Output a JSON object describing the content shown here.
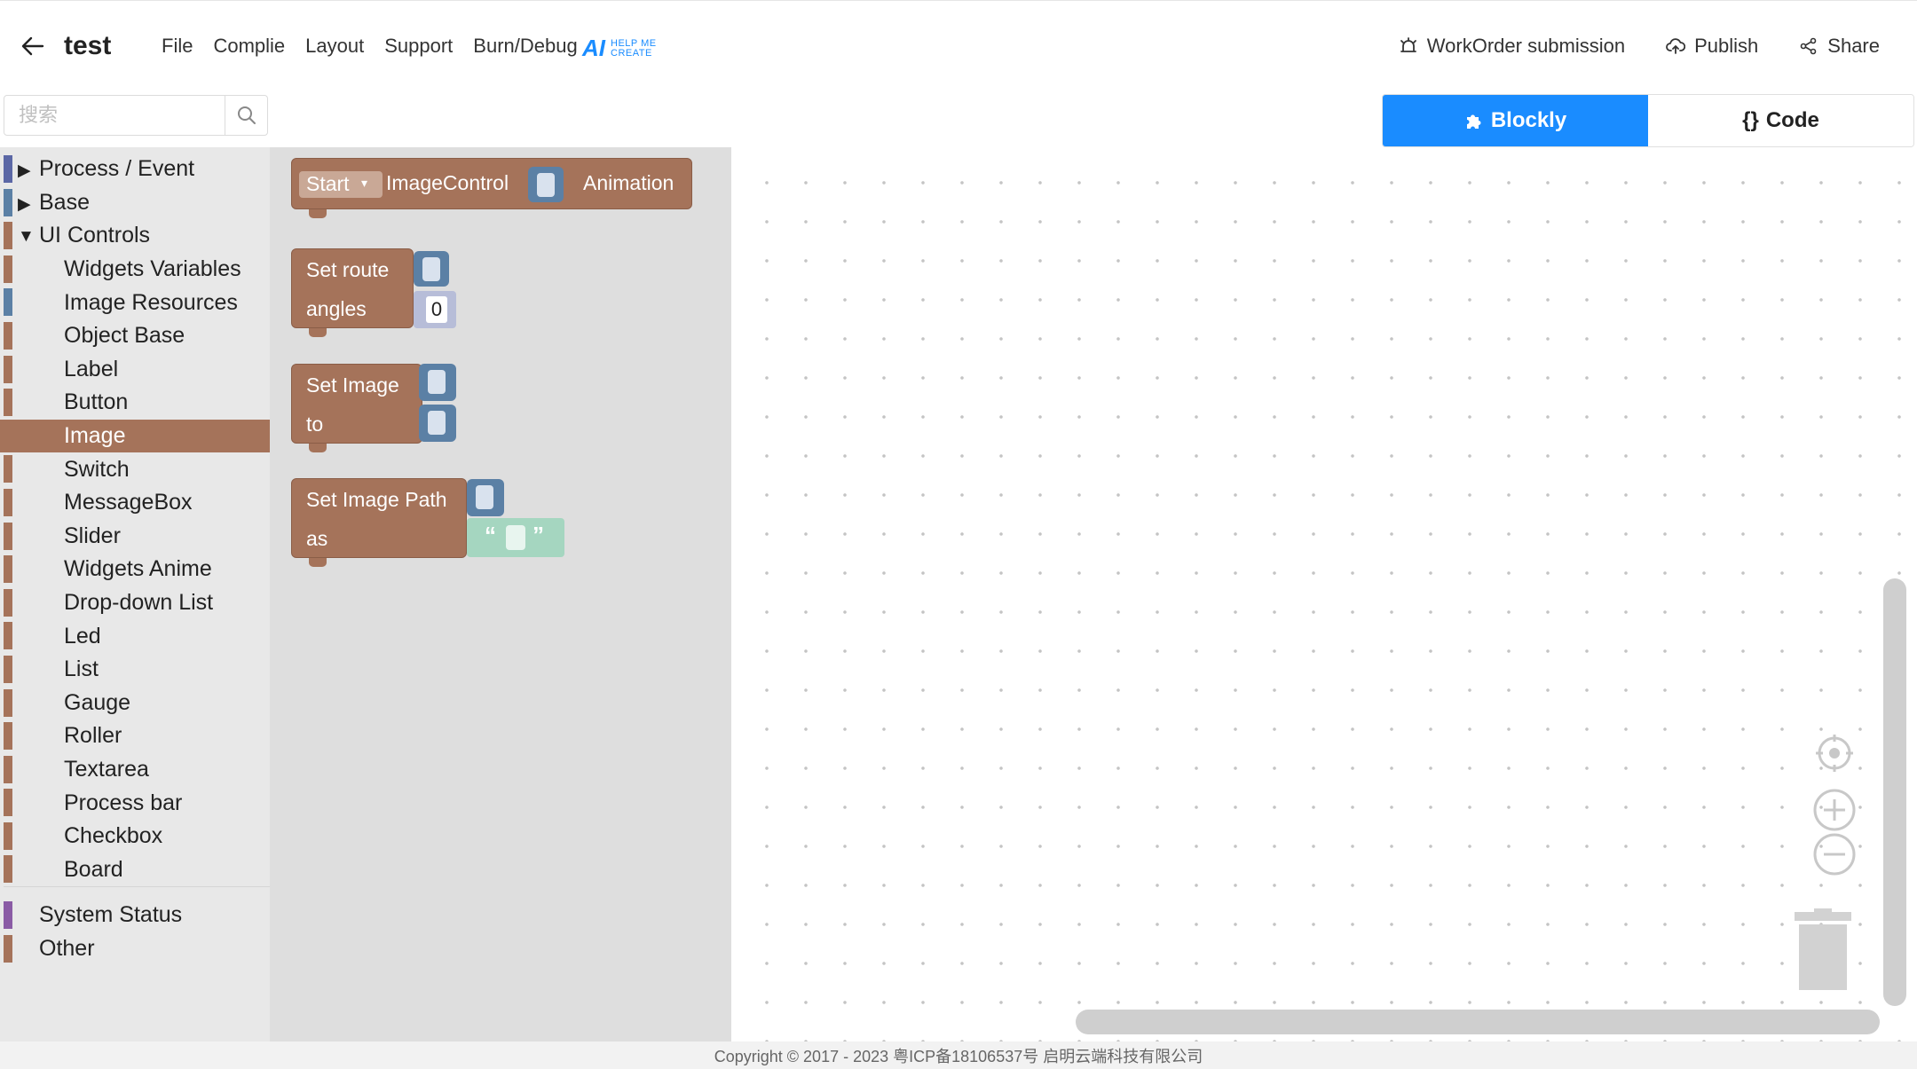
{
  "header": {
    "title": "test",
    "menu": [
      "File",
      "Complie",
      "Layout",
      "Support",
      "Burn/Debug"
    ],
    "ai_logo": {
      "mark": "AI",
      "line1": "HELP ME",
      "line2": "CREATE"
    },
    "actions": {
      "workorder": "WorkOrder submission",
      "publish": "Publish",
      "share": "Share"
    }
  },
  "search": {
    "placeholder": "搜索",
    "value": ""
  },
  "tabs": {
    "blockly": "Blockly",
    "code": "Code",
    "active": "blockly"
  },
  "toolbox": {
    "categories": [
      {
        "label": "Process / Event",
        "color": "#5b67a5",
        "expanded": false
      },
      {
        "label": "Base",
        "color": "#5b80a5",
        "expanded": false
      },
      {
        "label": "UI Controls",
        "color": "#a5735a",
        "expanded": true
      }
    ],
    "ui_controls": [
      "Widgets Variables",
      "Image Resources",
      "Object Base",
      "Label",
      "Button",
      "Image",
      "Switch",
      "MessageBox",
      "Slider",
      "Widgets Anime",
      "Drop-down List",
      "Led",
      "List",
      "Gauge",
      "Roller",
      "Textarea",
      "Process bar",
      "Checkbox",
      "Board"
    ],
    "selected": "Image",
    "bottom": [
      {
        "label": "System Status",
        "color": "#8a5ba5"
      },
      {
        "label": "Other",
        "color": "#a5735a"
      }
    ]
  },
  "flyout": {
    "block1": {
      "dropdown": "Start",
      "text1": "ImageControl",
      "text2": "Animation"
    },
    "block2": {
      "line1": "Set route",
      "line2": "angles",
      "value": "0"
    },
    "block3": {
      "line1": "Set Image",
      "line2": "to"
    },
    "block4": {
      "line1": "Set Image Path",
      "line2": "as",
      "quote_open": "“",
      "quote_close": "”"
    }
  },
  "footer": {
    "copyright": "Copyright © 2017 - 2023 粤ICP备18106537号 启明云端科技有限公司"
  },
  "colors": {
    "accent": "#1a8cff",
    "ui_block": "#a5735a",
    "variable_slot": "#5b80a5",
    "text_slot": "#a5d6c0"
  }
}
